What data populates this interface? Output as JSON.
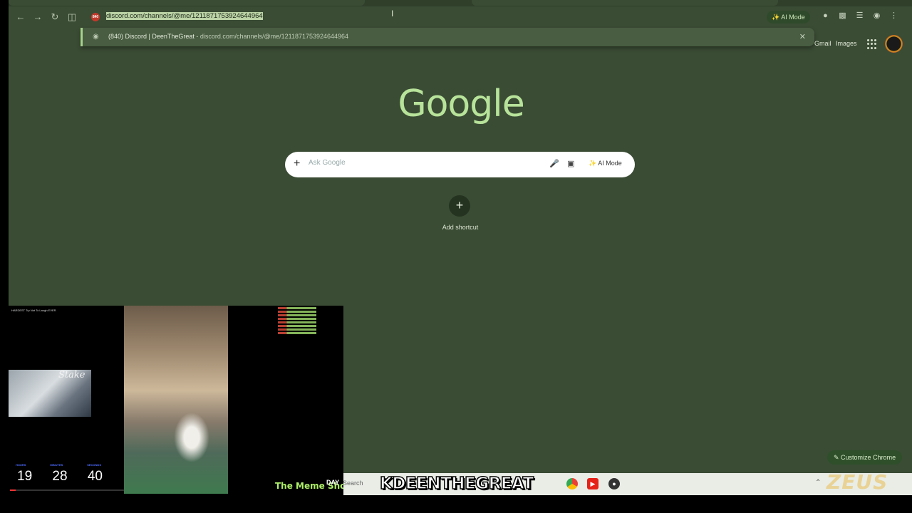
{
  "browser": {
    "url_display": "discord.com/channels/@me/1211871753924644964",
    "site_badge": "840",
    "ai_mode_label": "AI Mode"
  },
  "suggestion": {
    "title": "(840) Discord | DeenTheGreat",
    "separator": "-",
    "url": "discord.com/channels/@me/1211871753924644964"
  },
  "google": {
    "logo_text": "Google",
    "gmail_label": "Gmail",
    "images_label": "Images",
    "search_placeholder": "Ask Google",
    "ai_mode_label": "AI Mode",
    "add_shortcut_label": "Add shortcut",
    "customize_label": "Customize Chrome"
  },
  "taskbar": {
    "search_label": "Search",
    "watermark": "ZEUS"
  },
  "overlay": {
    "channel_name": "KDEENTHEGREAT",
    "timer": {
      "hours": "19",
      "minutes": "28",
      "seconds": "40",
      "hours_label": "HOURS",
      "minutes_label": "MINUTES",
      "seconds_label": "SECONDS"
    },
    "meme_text": "The Meme Shop",
    "day_text": "DAY",
    "video_title": "HARDEST Try Not To Laugh EVER",
    "webcam_logo": "Stake"
  },
  "colors": {
    "background": "#3a4c34",
    "accent": "#b7e39a"
  }
}
